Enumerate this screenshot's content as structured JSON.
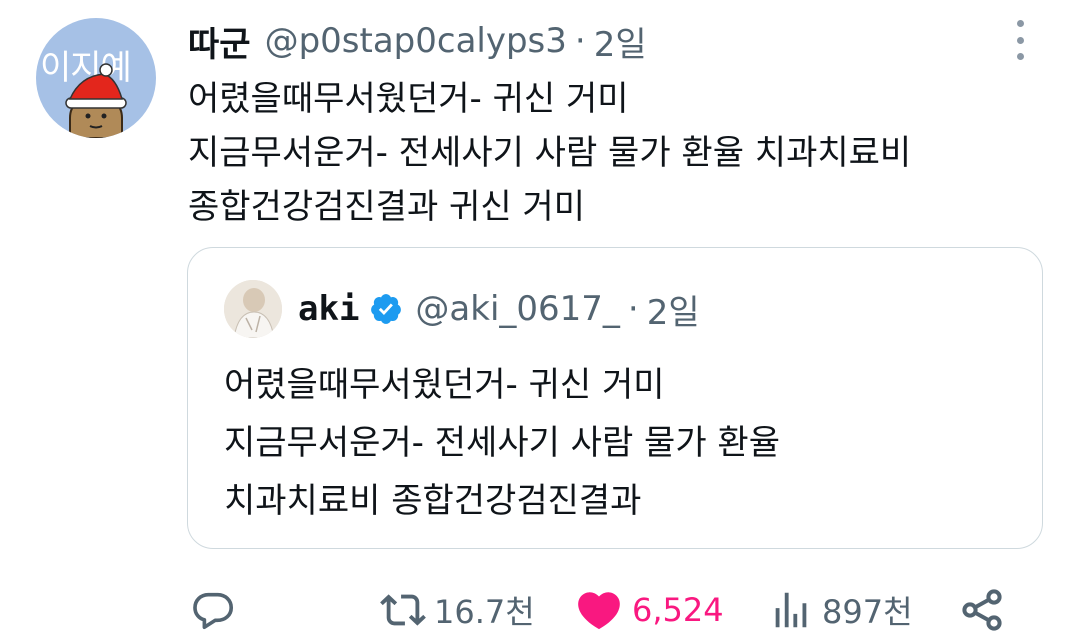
{
  "tweet": {
    "author": {
      "avatar_text": "이지예",
      "display_name": "따군",
      "handle": "@p0stap0calyps3",
      "time": "2일"
    },
    "separator": "·",
    "lines": [
      "어렸을때무서웠던거- 귀신 거미",
      "지금무서운거- 전세사기 사람 물가 환율 치과치료비",
      "종합건강검진결과 귀신 거미"
    ]
  },
  "quote": {
    "display_name": "aki",
    "handle": "@aki_0617_",
    "separator": "·",
    "time": "2일",
    "verified": true,
    "lines": [
      "어렸을때무서웠던거- 귀신 거미",
      "지금무서운거- 전세사기 사람 물가 환율",
      "치과치료비 종합건강검진결과"
    ]
  },
  "actions": {
    "reply": {
      "icon": "reply-icon",
      "count": ""
    },
    "retweet": {
      "icon": "retweet-icon",
      "count": "16.7천"
    },
    "like": {
      "icon": "heart-icon",
      "count": "6,524",
      "liked": true
    },
    "views": {
      "icon": "views-chart-icon",
      "count": "897천"
    },
    "share": {
      "icon": "share-icon"
    }
  },
  "colors": {
    "accent_like": "#f91880",
    "verified_blue": "#1d9bf0",
    "secondary_text": "#536471",
    "border": "#cfd9de"
  }
}
